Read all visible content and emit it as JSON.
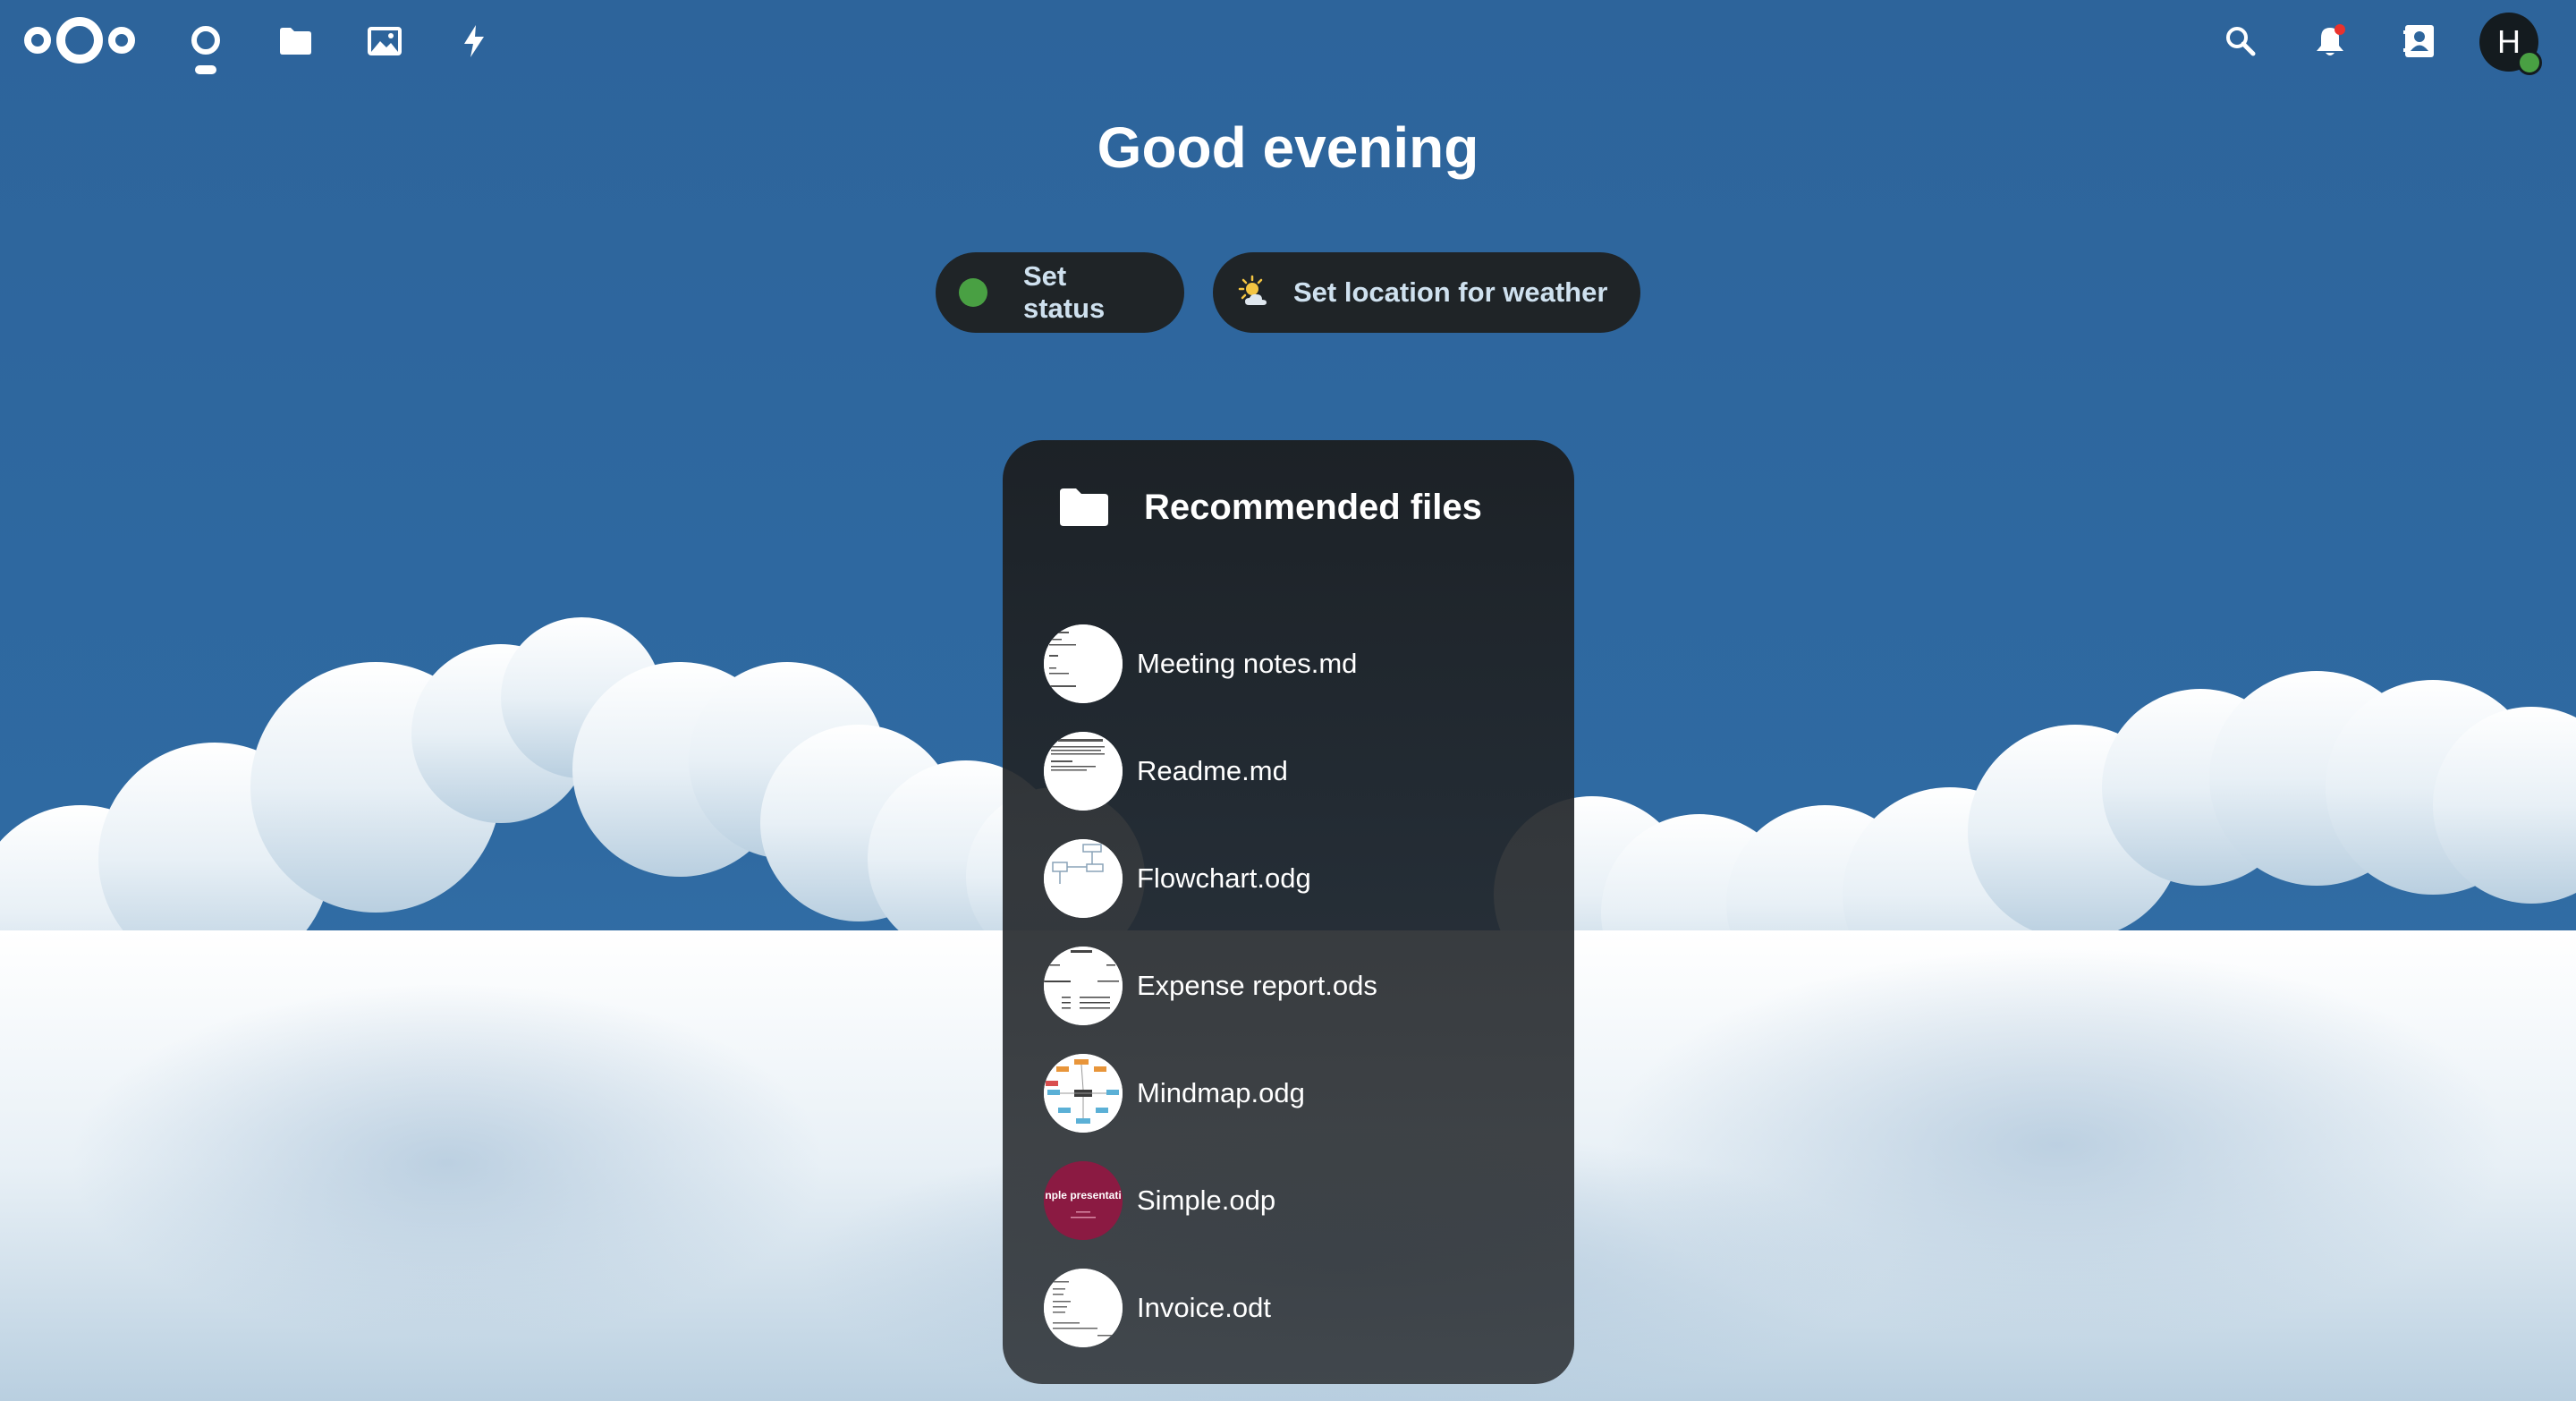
{
  "header": {
    "logo_icon": "nextcloud-logo-icon",
    "apps": [
      {
        "name": "Dashboard",
        "icon": "dashboard-icon"
      },
      {
        "name": "Files",
        "icon": "folder-icon"
      },
      {
        "name": "Photos",
        "icon": "image-icon"
      },
      {
        "name": "Activity",
        "icon": "lightning-icon"
      }
    ],
    "right_icons": [
      "search-icon",
      "bell-icon",
      "contacts-icon"
    ],
    "avatar_initial": "H",
    "avatar_status_color": "#49a043"
  },
  "greeting": "Good evening",
  "status_buttons": {
    "set_status": "Set status",
    "set_weather": "Set location for weather"
  },
  "panel": {
    "title": "Recommended files",
    "files": [
      {
        "name": "Meeting notes.md",
        "thumb": "document-thumb"
      },
      {
        "name": "Readme.md",
        "thumb": "document-thumb"
      },
      {
        "name": "Flowchart.odg",
        "thumb": "flowchart-thumb"
      },
      {
        "name": "Expense report.ods",
        "thumb": "spreadsheet-thumb"
      },
      {
        "name": "Mindmap.odg",
        "thumb": "mindmap-thumb"
      },
      {
        "name": "Simple.odp",
        "thumb": "presentation-thumb",
        "thumb_text": "nple presentati"
      },
      {
        "name": "Invoice.odt",
        "thumb": "invoice-thumb"
      }
    ]
  },
  "colors": {
    "background_sky": "#2d659c",
    "panel": "#22272b",
    "status_online": "#49a043",
    "presentation": "#8b1a42"
  }
}
